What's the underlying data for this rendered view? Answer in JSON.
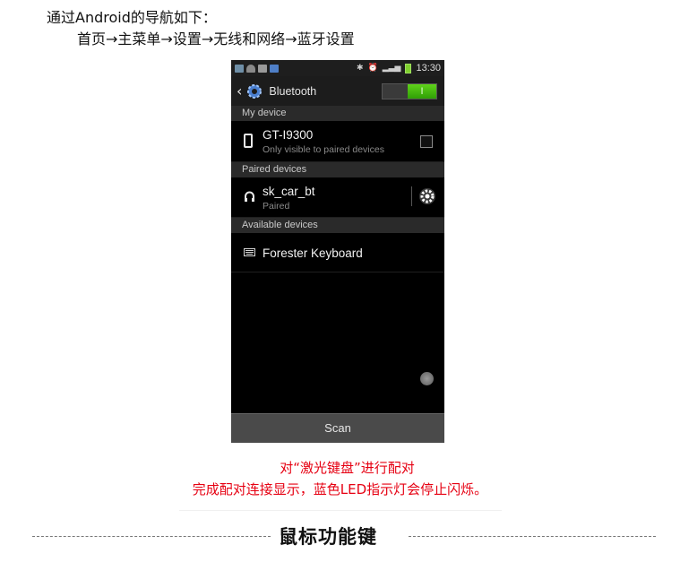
{
  "intro": {
    "line1": "通过Android的导航如下：",
    "line2": "首页→主菜单→设置→无线和网络→蓝牙设置"
  },
  "phone": {
    "status_bar": {
      "time": "13:30",
      "icons": [
        "gallery-icon",
        "android-icon",
        "robot-icon",
        "image-icon"
      ],
      "right_icons": [
        "bluetooth-icon",
        "alarm-icon",
        "signal-icon",
        "battery-icon"
      ]
    },
    "action_bar": {
      "back": "‹",
      "title": "Bluetooth",
      "toggle_label": "I",
      "toggle_on": true
    },
    "sections": {
      "my_device": "My device",
      "paired": "Paired devices",
      "available": "Available devices"
    },
    "my_device": {
      "name": "GT-I9300",
      "subtitle": "Only visible to paired devices",
      "icon": "phone-icon"
    },
    "paired_device": {
      "name": "sk_car_bt",
      "status": "Paired",
      "icon": "headphones-icon"
    },
    "available_device": {
      "name": "Forester Keyboard",
      "icon": "keyboard-icon"
    },
    "scan_label": "Scan"
  },
  "captions": {
    "line1": "对“激光键盘”进行配对",
    "line2": "完成配对连接显示，蓝色LED指示灯会停止闪烁。"
  },
  "footer": {
    "title": "鼠标功能键"
  },
  "colors": {
    "caption_red": "#e60012",
    "toggle_green": "#3fb10c"
  }
}
